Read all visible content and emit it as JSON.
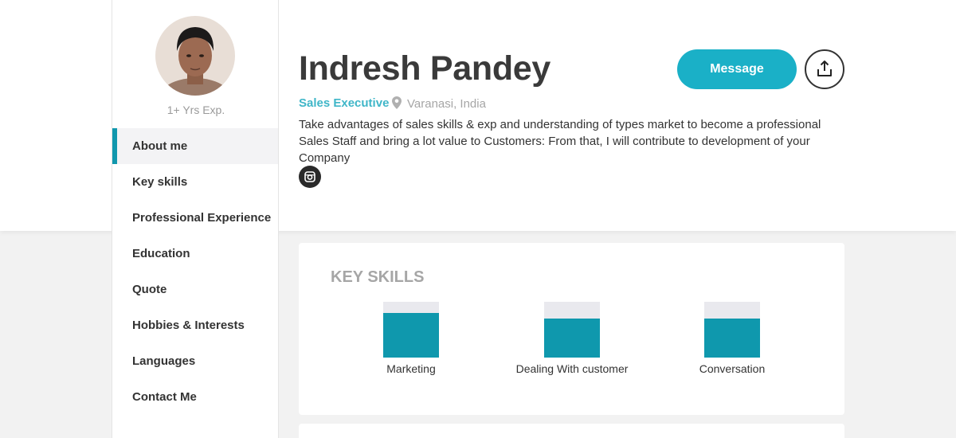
{
  "profile": {
    "name": "Indresh Pandey",
    "role": "Sales Executive",
    "location": "Varanasi, India",
    "experience": "1+ Yrs Exp.",
    "description": "Take advantages of sales skills & exp and understanding of types market to become a professional Sales Staff and bring a lot value to Customers: From that, I will contribute to development of your Company",
    "social_icon": "instagram-icon"
  },
  "actions": {
    "message_label": "Message",
    "share_icon": "share-upload-icon"
  },
  "sidebar": {
    "items": [
      {
        "label": "About me",
        "active": true
      },
      {
        "label": "Key skills",
        "active": false
      },
      {
        "label": "Professional Experience",
        "active": false
      },
      {
        "label": "Education",
        "active": false
      },
      {
        "label": "Quote",
        "active": false
      },
      {
        "label": "Hobbies & Interests",
        "active": false
      },
      {
        "label": "Languages",
        "active": false
      },
      {
        "label": "Contact Me",
        "active": false
      }
    ]
  },
  "key_skills": {
    "title": "KEY SKILLS",
    "skills": [
      {
        "label": "Marketing",
        "level": 0.8
      },
      {
        "label": "Dealing With customer",
        "level": 0.7
      },
      {
        "label": "Conversation",
        "level": 0.7
      }
    ]
  },
  "colors": {
    "accent": "#1ab0c7",
    "bar_fill": "#0f98ad",
    "role_text": "#3fb6c8"
  }
}
